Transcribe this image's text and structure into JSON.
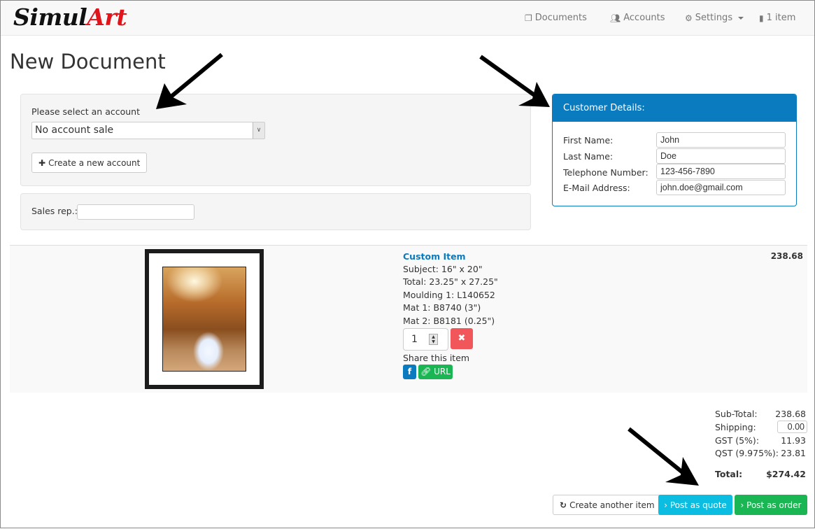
{
  "brand": {
    "part1": "Simul",
    "part2": "Art"
  },
  "nav": {
    "documents": {
      "icon": "documents-icon",
      "label": "Documents"
    },
    "accounts": {
      "icon": "users-icon",
      "label": "Accounts"
    },
    "settings": {
      "icon": "gear-icon",
      "label": "Settings"
    },
    "cart": {
      "icon": "file-icon",
      "label": "1 item"
    }
  },
  "page_title": "New Document",
  "account": {
    "label": "Please select an account",
    "selected": "No account sale",
    "create_button": "Create a new account"
  },
  "sales_rep": {
    "label": "Sales rep.:",
    "value": ""
  },
  "customer": {
    "heading": "Customer Details:",
    "fields": [
      {
        "label": "First Name:",
        "value": "John"
      },
      {
        "label": "Last Name:",
        "value": "Doe"
      },
      {
        "label": "Telephone Number:",
        "value": "123-456-7890"
      },
      {
        "label": "E-Mail Address:",
        "value": "john.doe@gmail.com"
      }
    ]
  },
  "item": {
    "title": "Custom Item",
    "details": [
      "Subject: 16\" x 20\"",
      "Total: 23.25\" x 27.25\"",
      "Moulding 1: L140652",
      "Mat 1: B8740 (3\")",
      "Mat 2: B8181 (0.25\")"
    ],
    "quantity": "1",
    "share_label": "Share this item",
    "facebook_label": "f",
    "url_label": "URL",
    "price": "238.68"
  },
  "totals": {
    "subtotal_label": "Sub-Total:",
    "subtotal": "238.68",
    "shipping_label": "Shipping:",
    "shipping": "0.00",
    "gst_label": "GST (5%):",
    "gst": "11.93",
    "qst_label": "QST (9.975%):",
    "qst": "23.81",
    "total_label": "Total:",
    "total": "$274.42"
  },
  "actions": {
    "create_another": "Create another item",
    "post_quote": "Post as quote",
    "post_order": "Post as order"
  }
}
